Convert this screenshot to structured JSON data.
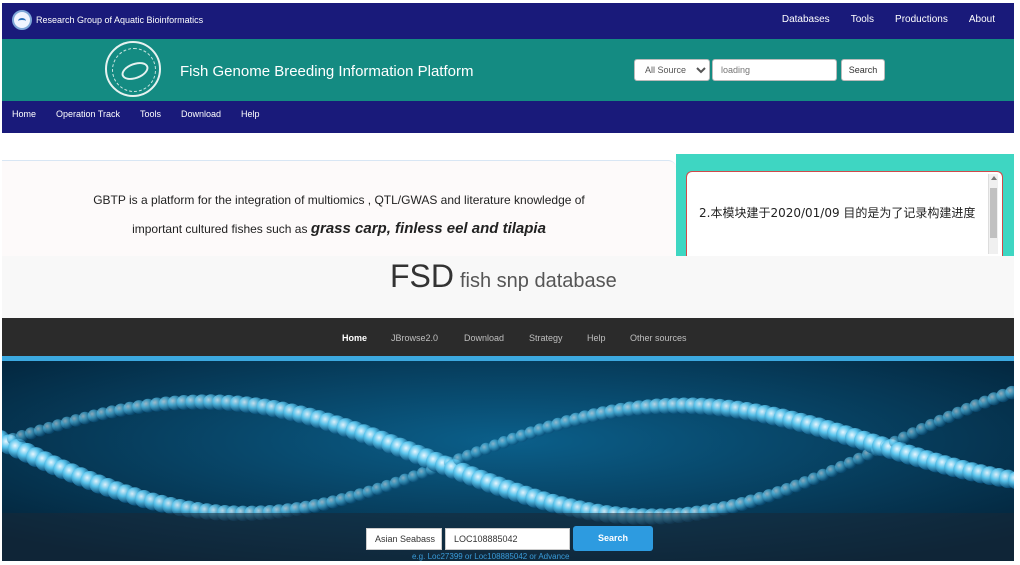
{
  "topbar": {
    "brand": "Research Group of Aquatic Bioinformatics",
    "nav": [
      "Databases",
      "Tools",
      "Productions",
      "About"
    ]
  },
  "header": {
    "title": "Fish Genome Breeding Information Platform",
    "source_select": "All Source",
    "search_placeholder": "loading",
    "search_button": "Search"
  },
  "main_nav": [
    "Home",
    "Operation Track",
    "Tools",
    "Download",
    "Help"
  ],
  "intro": {
    "line1": "GBTP is a platform for the integration of multiomics , QTL/GWAS and literature knowledge of",
    "line2_prefix": "important cultured fishes such as ",
    "line2_species": "grass carp, finless eel and tilapia"
  },
  "news": {
    "text": "2.本模块建于2020/01/09 目的是为了记录构建进度"
  },
  "fsd": {
    "title": "FSD",
    "subtitle": "fish snp database",
    "nav": [
      "Home",
      "JBrowse2.0",
      "Download",
      "Strategy",
      "Help",
      "Other sources"
    ],
    "active_nav": "Home"
  },
  "hero_search": {
    "species": "Asian Seabass",
    "query": "LOC108885042",
    "button": "Search",
    "hint": "e.g. Loc27399 or Loc108885042 or Advance"
  },
  "colors": {
    "navy": "#191a7a",
    "teal": "#148b82",
    "news_bg": "#3ed6c2",
    "fsd_nav": "#2b2b2b",
    "accent_blue": "#3ca9e0"
  }
}
